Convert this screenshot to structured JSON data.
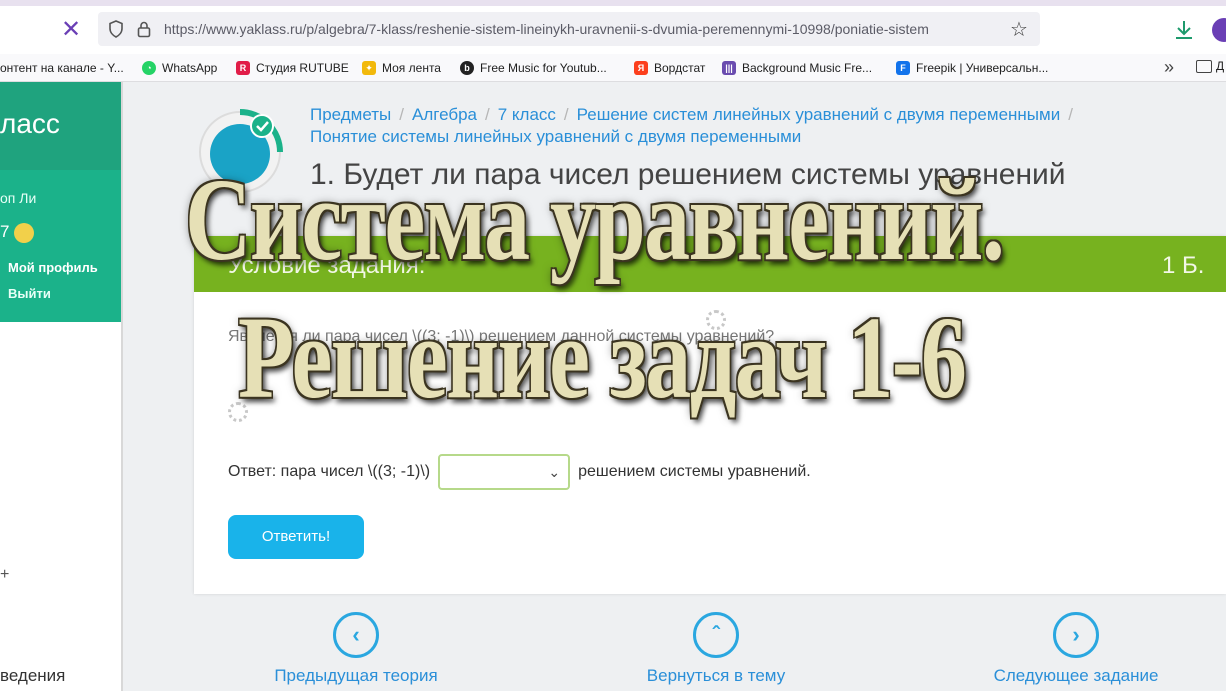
{
  "browser": {
    "url": "https://www.yaklass.ru/p/algebra/7-klass/reshenie-sistem-lineinykh-uravnenii-s-dvumia-peremennymi-10998/poniatie-sistem",
    "profile_initial": "",
    "bookmarks": [
      {
        "label": "онтент на канале - Y...",
        "color": "#ff0000"
      },
      {
        "label": "WhatsApp",
        "color": "#25d366"
      },
      {
        "label": "Студия RUTUBE",
        "color": "#e11d48"
      },
      {
        "label": "Моя лента",
        "color": "#f2b90c"
      },
      {
        "label": "Free Music for Youtub...",
        "color": "#222222"
      },
      {
        "label": "Вордстат",
        "color": "#fc3f1d"
      },
      {
        "label": "Background Music Fre...",
        "color": "#6a4caf"
      },
      {
        "label": "Freepik | Универсальн...",
        "color": "#1273eb"
      }
    ],
    "folder_label": "Д"
  },
  "sidebar": {
    "logo": "ласс",
    "user_name": "оп Ли",
    "points": "7",
    "profile_link": "Мой профиль",
    "logout_link": "Выйти",
    "plus": "+",
    "bottom_text": "ведения"
  },
  "breadcrumbs": [
    "Предметы",
    "Алгебра",
    "7 класс",
    "Решение систем линейных уравнений с двумя переменными",
    "Понятие системы линейных уравнений с двумя переменными"
  ],
  "task": {
    "title": "1. Будет ли пара чисел решением системы уравнений",
    "condition_header": "Условие задания:",
    "score": "1 Б.",
    "question": "Является ли пара чисел \\((3; -1)\\) решением данной системы уравнений?",
    "answer_prefix": "Ответ: пара чисел \\((3; -1)\\)",
    "answer_select_value": "",
    "answer_suffix": "решением системы уравнений.",
    "submit_label": "Ответить!"
  },
  "navigation": {
    "prev": "Предыдущая теория",
    "back": "Вернуться в тему",
    "next": "Следующее задание"
  },
  "overlay": {
    "line1": "Система уравнений.",
    "line2": "Решение задач 1-6"
  },
  "colors": {
    "sidebar_dark": "#1fa37e",
    "sidebar_light": "#1bb28a",
    "card_header": "#77b21f",
    "link": "#2a8fd8",
    "button": "#19b3ea"
  }
}
